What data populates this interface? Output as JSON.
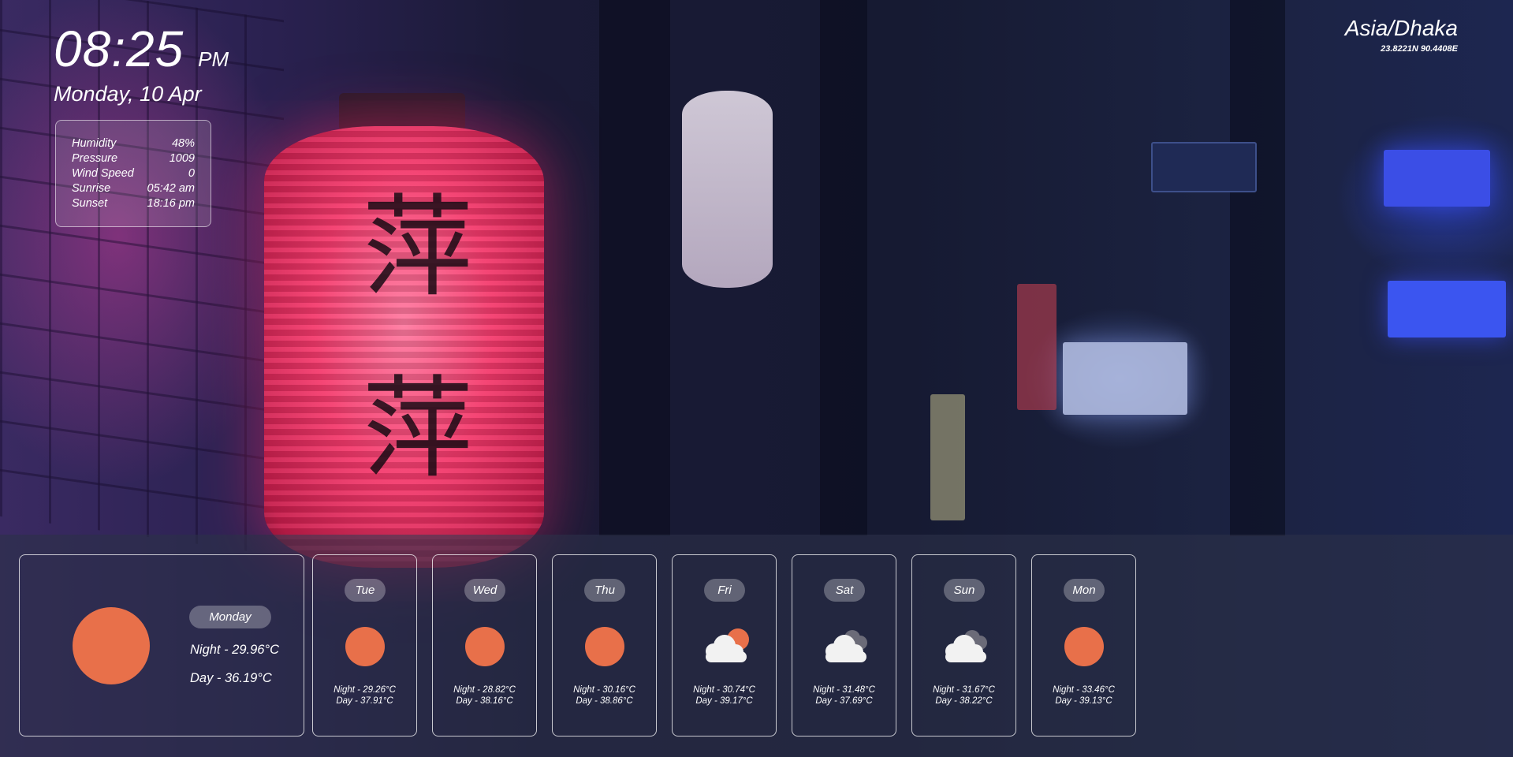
{
  "clock": {
    "time": "08:25",
    "ampm": "PM",
    "date": "Monday, 10 Apr"
  },
  "stats": [
    {
      "label": "Humidity",
      "value": "48%"
    },
    {
      "label": "Pressure",
      "value": "1009"
    },
    {
      "label": "Wind Speed",
      "value": "0"
    },
    {
      "label": "Sunrise",
      "value": "05:42 am"
    },
    {
      "label": "Sunset",
      "value": "18:16 pm"
    }
  ],
  "location": {
    "name": "Asia/Dhaka",
    "coords": "23.8221N 90.4408E"
  },
  "today": {
    "day": "Monday",
    "night": "Night - 29.96°C",
    "dayTemp": "Day - 36.19°C",
    "icon": "sun-icon"
  },
  "forecast": [
    {
      "day": "Tue",
      "night": "Night - 29.26°C",
      "dayTemp": "Day - 37.91°C",
      "icon": "sun-icon"
    },
    {
      "day": "Wed",
      "night": "Night - 28.82°C",
      "dayTemp": "Day - 38.16°C",
      "icon": "sun-icon"
    },
    {
      "day": "Thu",
      "night": "Night - 30.16°C",
      "dayTemp": "Day - 38.86°C",
      "icon": "sun-icon"
    },
    {
      "day": "Fri",
      "night": "Night - 30.74°C",
      "dayTemp": "Day - 39.17°C",
      "icon": "partly-cloudy-icon"
    },
    {
      "day": "Sat",
      "night": "Night - 31.48°C",
      "dayTemp": "Day - 37.69°C",
      "icon": "cloudy-icon"
    },
    {
      "day": "Sun",
      "night": "Night - 31.67°C",
      "dayTemp": "Day - 38.22°C",
      "icon": "cloudy-icon"
    },
    {
      "day": "Mon",
      "night": "Night - 33.46°C",
      "dayTemp": "Day - 39.13°C",
      "icon": "sun-icon"
    }
  ],
  "colors": {
    "sun": "#e8704a",
    "cloud": "#f2f2f2",
    "cloudDark": "#6b6b78"
  }
}
